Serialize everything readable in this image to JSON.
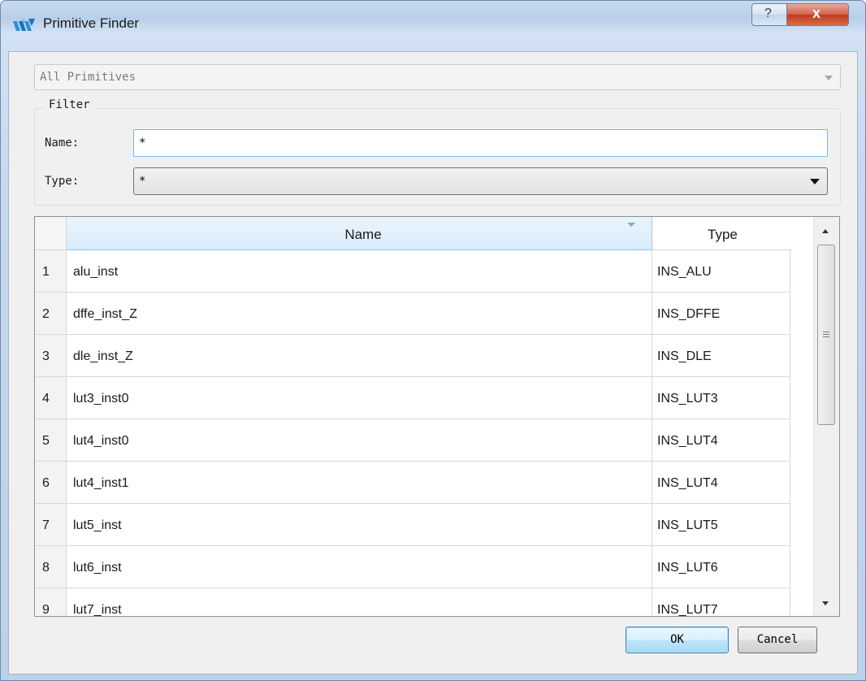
{
  "window": {
    "title": "Primitive Finder",
    "help_glyph": "?",
    "close_glyph": "x"
  },
  "scope_combo": {
    "value": "All Primitives"
  },
  "filter": {
    "legend": "Filter",
    "name_label": "Name:",
    "name_value": "*",
    "type_label": "Type:",
    "type_value": "*"
  },
  "table": {
    "columns": [
      "Name",
      "Type"
    ],
    "rows": [
      {
        "num": "1",
        "name": "alu_inst",
        "type": "INS_ALU"
      },
      {
        "num": "2",
        "name": "dffe_inst_Z",
        "type": "INS_DFFE"
      },
      {
        "num": "3",
        "name": "dle_inst_Z",
        "type": "INS_DLE"
      },
      {
        "num": "4",
        "name": "lut3_inst0",
        "type": "INS_LUT3"
      },
      {
        "num": "5",
        "name": "lut4_inst0",
        "type": "INS_LUT4"
      },
      {
        "num": "6",
        "name": "lut4_inst1",
        "type": "INS_LUT4"
      },
      {
        "num": "7",
        "name": "lut5_inst",
        "type": "INS_LUT5"
      },
      {
        "num": "8",
        "name": "lut6_inst",
        "type": "INS_LUT6"
      },
      {
        "num": "9",
        "name": "lut7_inst",
        "type": "INS_LUT7"
      }
    ]
  },
  "buttons": {
    "ok": "OK",
    "cancel": "Cancel"
  },
  "colors": {
    "accent": "#7eb4ea",
    "title_bar": "#c6d9ef",
    "close_button": "#c23a1f"
  },
  "icons": {
    "app": "primitive-finder-logo-icon",
    "sort": "sort-indicator-icon"
  }
}
